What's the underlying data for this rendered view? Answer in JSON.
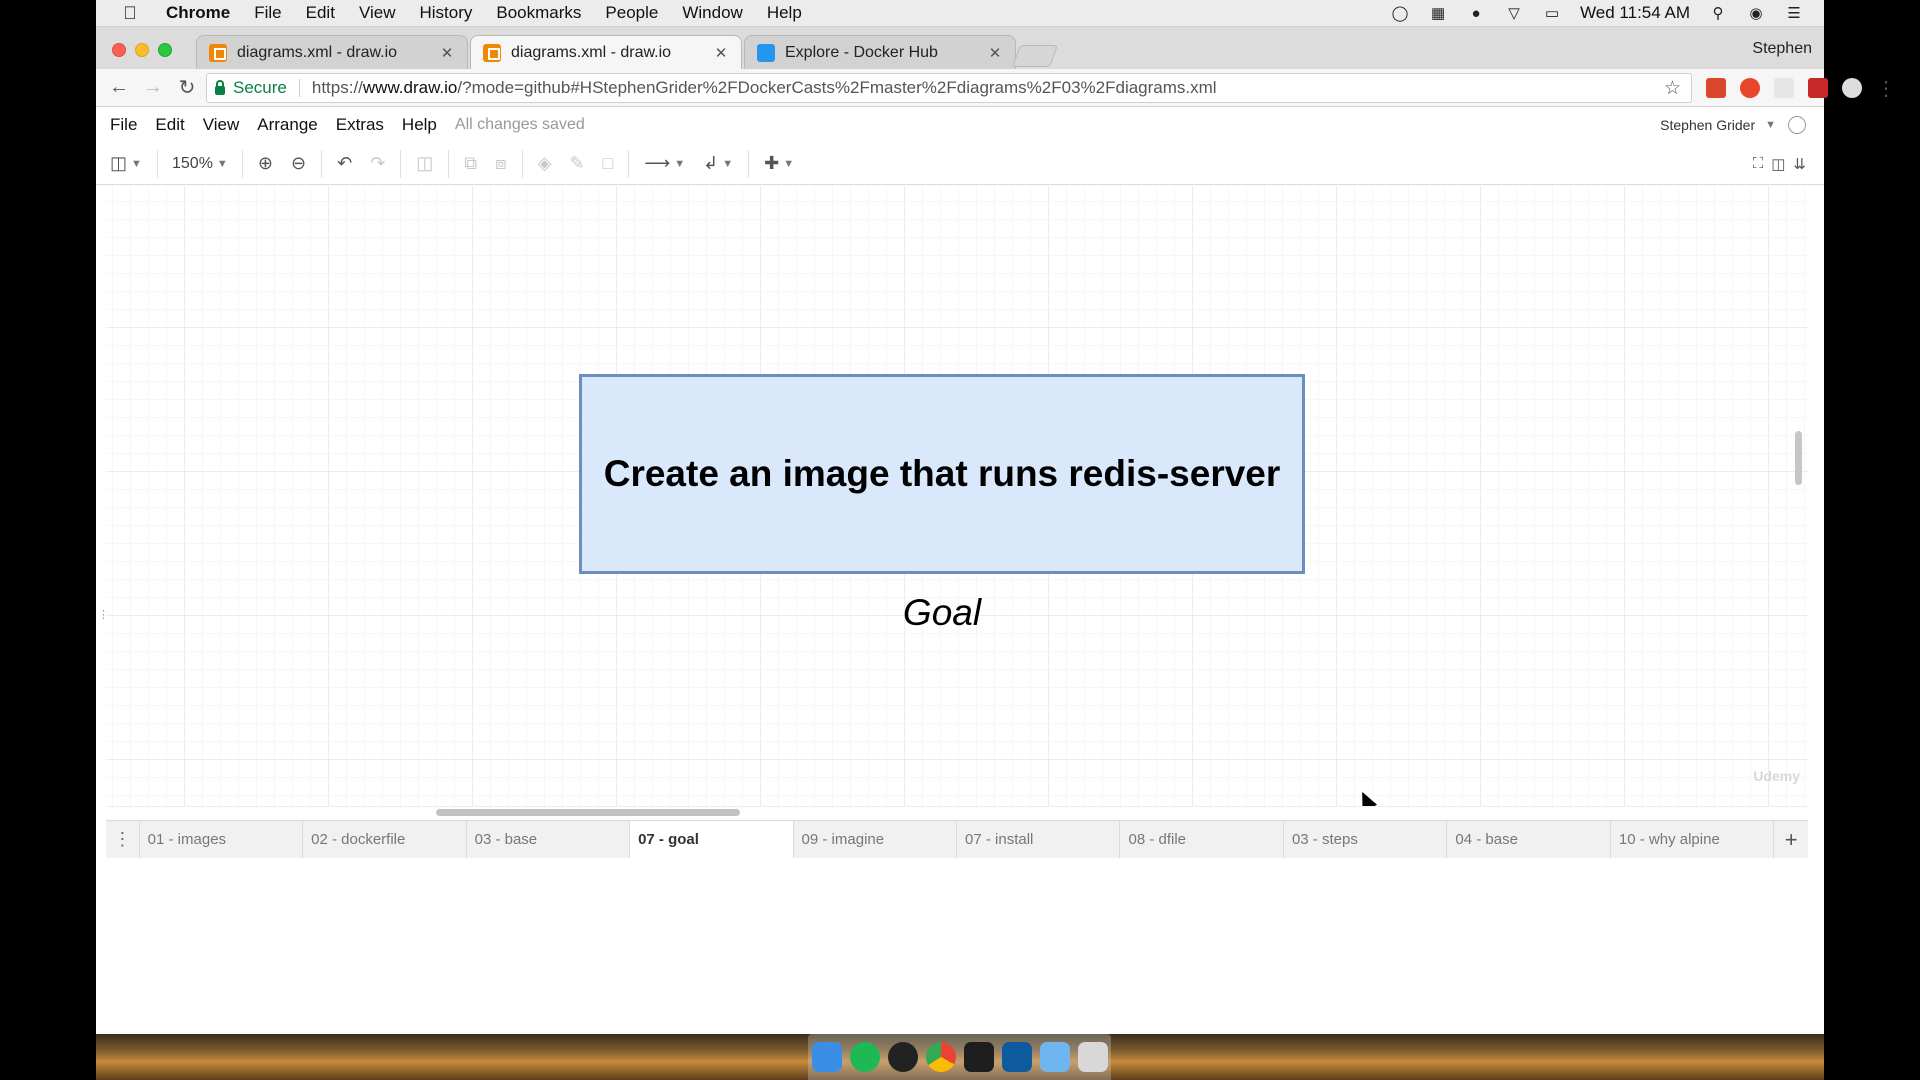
{
  "macos_menubar": {
    "app_name": "Chrome",
    "menus": [
      "File",
      "Edit",
      "View",
      "History",
      "Bookmarks",
      "People",
      "Window",
      "Help"
    ],
    "clock": "Wed 11:54 AM"
  },
  "browser": {
    "tabs": [
      {
        "title": "diagrams.xml - draw.io",
        "favicon": "drawio-icon",
        "active": false
      },
      {
        "title": "diagrams.xml - draw.io",
        "favicon": "drawio-icon",
        "active": true
      },
      {
        "title": "Explore - Docker Hub",
        "favicon": "docker-icon",
        "active": false
      }
    ],
    "profile": "Stephen",
    "secure_label": "Secure",
    "url_prefix": "https://",
    "url_host": "www.draw.io",
    "url_rest": "/?mode=github#HStephenGrider%2FDockerCasts%2Fmaster%2Fdiagrams%2F03%2Fdiagrams.xml"
  },
  "drawio": {
    "menus": [
      "File",
      "Edit",
      "View",
      "Arrange",
      "Extras",
      "Help"
    ],
    "save_status": "All changes saved",
    "user": "Stephen Grider",
    "zoom": "150%",
    "shape_text": "Create an image that runs redis-server",
    "caption": "Goal",
    "watermark": "Udemy",
    "pages": [
      "01 - images",
      "02 - dockerfile",
      "03 - base",
      "07 - goal",
      "09 - imagine",
      "07 - install",
      "08 - dfile",
      "03 - steps",
      "04 - base",
      "10 - why alpine"
    ],
    "active_page": "07 - goal"
  },
  "colors": {
    "shape_fill": "#dae8fc",
    "shape_stroke": "#6c8ebf"
  }
}
